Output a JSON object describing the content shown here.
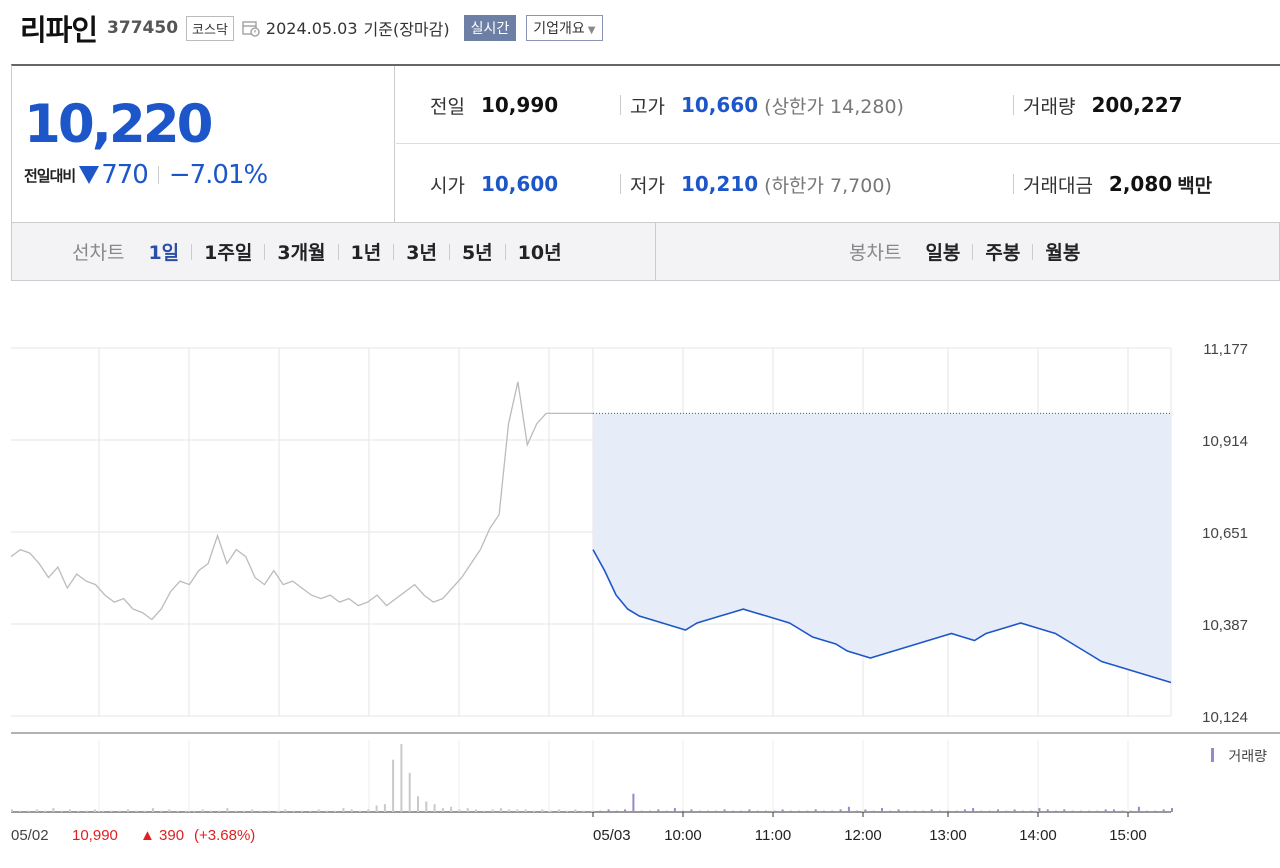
{
  "header": {
    "name": "리파인",
    "code": "377450",
    "market": "코스닥",
    "date": "2024.05.03",
    "basis": "기준(장마감)",
    "realtime_label": "실시간",
    "company_label": "기업개요"
  },
  "price": {
    "current": "10,220",
    "change_label": "전일대비",
    "change_amount": "770",
    "change_pct": "−7.01%"
  },
  "stats": {
    "prev_label": "전일",
    "prev": "10,990",
    "high_label": "고가",
    "high": "10,660",
    "upper_limit": "(상한가 14,280)",
    "volume_label": "거래량",
    "volume": "200,227",
    "open_label": "시가",
    "open": "10,600",
    "low_label": "저가",
    "low": "10,210",
    "lower_limit": "(하한가 7,700)",
    "amount_label": "거래대금",
    "amount": "2,080",
    "amount_unit": "백만"
  },
  "tabs": {
    "line_label": "선차트",
    "line_periods": [
      "1일",
      "1주일",
      "3개월",
      "1년",
      "3년",
      "5년",
      "10년"
    ],
    "active": "1일",
    "candle_label": "봉차트",
    "candle_periods": [
      "일봉",
      "주봉",
      "월봉"
    ]
  },
  "colors": {
    "blue": "#1d56c9",
    "fill": "#e6ecf8",
    "prev_line": "#bbbbbb",
    "volume": "#9b86c7",
    "red": "#e02020"
  },
  "chart_data": {
    "type": "line",
    "y_ticks": [
      "11,177",
      "10,914",
      "10,651",
      "10,387",
      "10,124"
    ],
    "ylim": [
      10124,
      11177
    ],
    "x_ticks": [
      "05/03",
      "10:00",
      "11:00",
      "12:00",
      "13:00",
      "14:00",
      "15:00"
    ],
    "prev_day_label": "05/02",
    "prev_day_close": "10,990",
    "prev_day_change": "▲ 390",
    "prev_day_pct": "(+3.68%)",
    "volume_legend": "거래량",
    "reference_price": 10990,
    "series": [
      {
        "name": "05/02",
        "values": [
          10580,
          10600,
          10590,
          10560,
          10520,
          10550,
          10490,
          10530,
          10510,
          10500,
          10470,
          10450,
          10460,
          10430,
          10420,
          10400,
          10430,
          10480,
          10510,
          10500,
          10540,
          10560,
          10640,
          10560,
          10600,
          10580,
          10520,
          10500,
          10540,
          10500,
          10510,
          10490,
          10470,
          10460,
          10470,
          10450,
          10460,
          10440,
          10450,
          10470,
          10440,
          10460,
          10480,
          10500,
          10470,
          10450,
          10460,
          10490,
          10520,
          10560,
          10600,
          10660,
          10700,
          10960,
          11080,
          10900,
          10960,
          10990,
          10990,
          10990,
          10990,
          10990,
          10990
        ]
      },
      {
        "name": "05/03",
        "values": [
          10600,
          10540,
          10470,
          10430,
          10410,
          10400,
          10390,
          10380,
          10370,
          10390,
          10400,
          10410,
          10420,
          10430,
          10420,
          10410,
          10400,
          10390,
          10370,
          10350,
          10340,
          10330,
          10310,
          10300,
          10290,
          10300,
          10310,
          10320,
          10330,
          10340,
          10350,
          10360,
          10350,
          10340,
          10360,
          10370,
          10380,
          10390,
          10380,
          10370,
          10360,
          10340,
          10320,
          10300,
          10280,
          10270,
          10260,
          10250,
          10240,
          10230,
          10220
        ]
      }
    ],
    "volume": [
      2,
      1,
      1,
      2,
      1,
      3,
      1,
      2,
      1,
      1,
      2,
      1,
      1,
      1,
      2,
      1,
      1,
      3,
      1,
      2,
      1,
      1,
      1,
      2,
      1,
      1,
      3,
      1,
      1,
      2,
      1,
      1,
      1,
      2,
      1,
      1,
      1,
      2,
      1,
      1,
      3,
      2,
      1,
      2,
      5,
      6,
      40,
      52,
      30,
      12,
      8,
      6,
      3,
      4,
      2,
      3,
      2,
      1,
      2,
      3,
      2,
      2,
      2,
      1,
      2,
      1,
      2,
      1,
      2,
      1,
      1,
      1,
      2,
      1,
      2,
      14,
      1,
      1,
      2,
      1,
      3,
      1,
      2,
      1,
      1,
      1,
      2,
      1,
      1,
      2,
      1,
      1,
      1,
      2,
      1,
      1,
      1,
      2,
      1,
      1,
      2,
      4,
      1,
      2,
      1,
      3,
      1,
      2,
      1,
      1,
      1,
      2,
      1,
      1,
      1,
      2,
      3,
      1,
      1,
      2,
      1,
      2,
      1,
      1,
      3,
      2,
      1,
      2,
      1,
      1,
      1,
      1,
      2,
      2,
      1,
      1,
      4,
      1,
      1,
      2,
      3
    ]
  }
}
